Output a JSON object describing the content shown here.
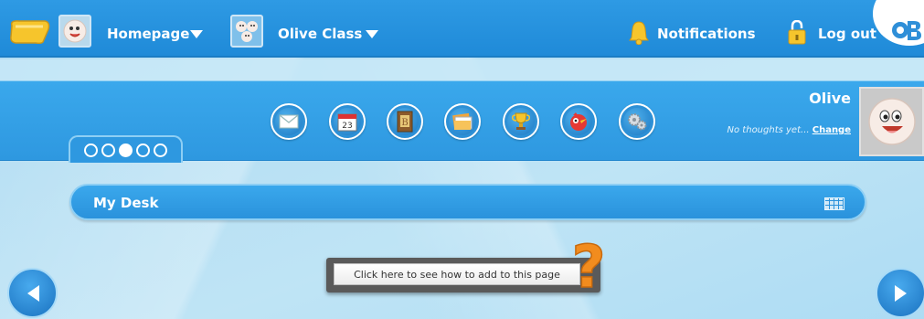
{
  "topbar": {
    "home_label": "Homepage",
    "class_label": "Olive Class",
    "notifications_label": "Notifications",
    "logout_label": "Log out"
  },
  "toolbar": {
    "icons": [
      {
        "name": "messages-icon"
      },
      {
        "name": "calendar-icon",
        "text": "23"
      },
      {
        "name": "book-icon",
        "text": "B"
      },
      {
        "name": "files-icon"
      },
      {
        "name": "trophy-icon"
      },
      {
        "name": "bird-icon"
      },
      {
        "name": "settings-icon"
      }
    ]
  },
  "profile": {
    "name": "Olive",
    "thoughts": "No thoughts yet...",
    "change_label": "Change"
  },
  "pager": {
    "total": 5,
    "active_index": 2
  },
  "desk": {
    "title": "My Desk"
  },
  "help": {
    "label": "Click here to see how to add to this page",
    "qmark_label": "?"
  },
  "colors": {
    "bar_blue": "#1f8ad8",
    "band_blue": "#2e98e0",
    "page_bg": "#bfe4f5",
    "help_orange": "#f28c1e"
  }
}
